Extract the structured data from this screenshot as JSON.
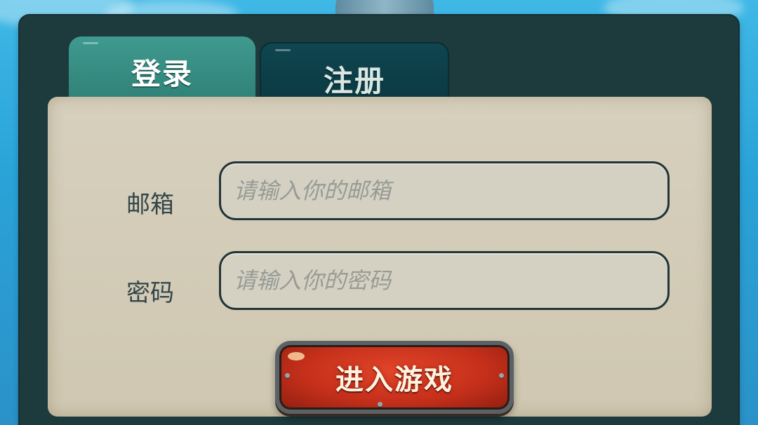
{
  "tabs": {
    "login_label": "登录",
    "register_label": "注册"
  },
  "form": {
    "email_label": "邮箱",
    "email_placeholder": "请输入你的邮箱",
    "email_value": "",
    "password_label": "密码",
    "password_placeholder": "请输入你的密码",
    "password_value": ""
  },
  "actions": {
    "enter_label": "进入游戏"
  },
  "colors": {
    "frame": "#1d3a3d",
    "active_tab": "#3f9a8f",
    "inactive_tab": "#0f4650",
    "panel": "#d7d0bd",
    "button": "#c6301b"
  }
}
